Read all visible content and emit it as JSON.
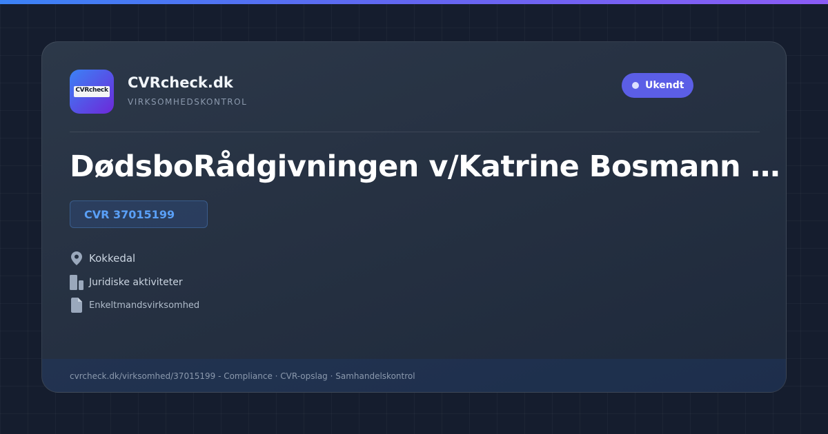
{
  "brand": {
    "logo_text": "CVRcheck",
    "name": "CVRcheck.dk",
    "subtitle": "VIRKSOMHEDSKONTROL"
  },
  "status": {
    "label": "Ukendt",
    "color": "#5b5ee6"
  },
  "company": {
    "name": "DødsboRådgivningen v/Katrine Bosmann R…",
    "cvr": "CVR 37015199",
    "location": "Kokkedal",
    "industry": "Juridiske aktiviteter",
    "type": "Enkeltmandsvirksomhed"
  },
  "icons": {
    "location": "map-pin-icon",
    "industry": "building-icon",
    "type": "document-icon"
  },
  "footer": {
    "text": "cvrcheck.dk/virksomhed/37015199 - Compliance · CVR-opslag · Samhandelskontrol"
  },
  "colors": {
    "accent": "#3b82f6",
    "accent_purple": "#8b5cf6",
    "background": "#151d2e"
  }
}
